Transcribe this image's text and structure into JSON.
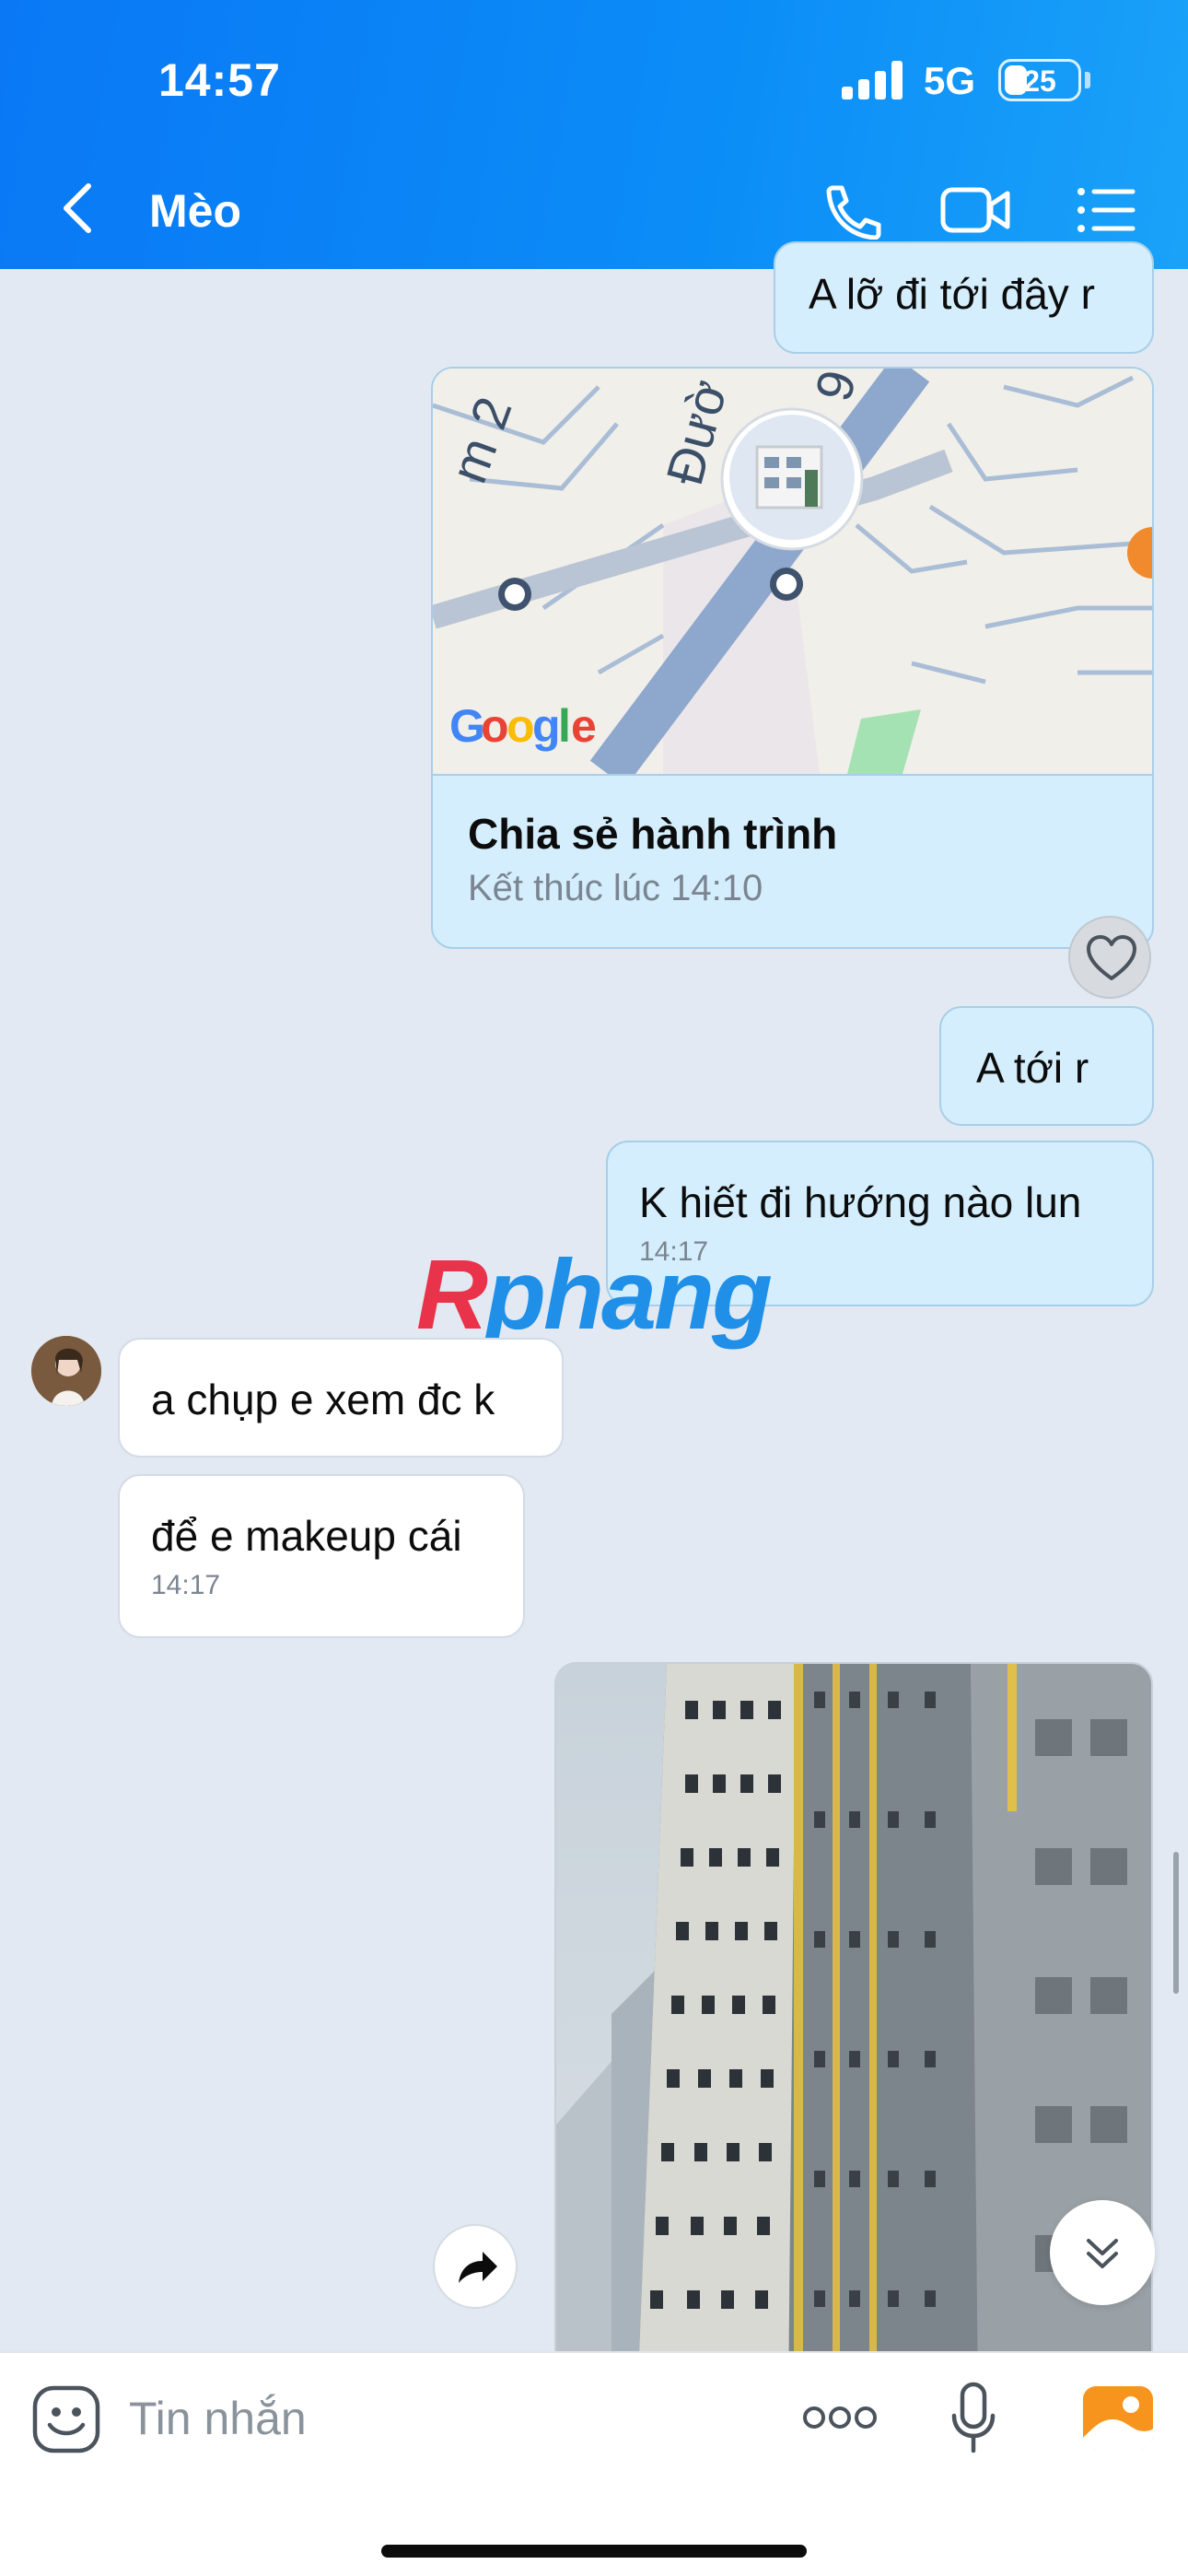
{
  "status_bar": {
    "time": "14:57",
    "network": "5G",
    "battery": "25"
  },
  "header": {
    "title": "Mèo",
    "back_icon": "chevron-left-icon",
    "actions": [
      "phone-icon",
      "video-call-icon",
      "menu-list-icon"
    ]
  },
  "messages": [
    {
      "id": "m1",
      "direction": "out",
      "text": "A lỡ đi tới đây r"
    },
    {
      "id": "m2",
      "direction": "out",
      "type": "location-share",
      "title": "Chia sẻ hành trình",
      "subtitle": "Kết thúc lúc 14:10",
      "map_brand": "Google"
    },
    {
      "id": "m3",
      "direction": "out",
      "text": "A tới r"
    },
    {
      "id": "m4",
      "direction": "out",
      "text": "K hiết đi hướng nào lun",
      "time": "14:17"
    },
    {
      "id": "m5",
      "direction": "in",
      "text": "a chụp e xem đc k"
    },
    {
      "id": "m6",
      "direction": "in",
      "text": "để e makeup cái",
      "time": "14:17"
    },
    {
      "id": "m7",
      "direction": "out",
      "type": "photo"
    }
  ],
  "watermark": {
    "first": "R",
    "rest": "phang"
  },
  "composer": {
    "placeholder": "Tin nhắn"
  },
  "colors": {
    "header": "#0a78f5",
    "bubble_out": "#d4eefd",
    "bubble_in": "#ffffff",
    "background": "#e3e9f2"
  }
}
